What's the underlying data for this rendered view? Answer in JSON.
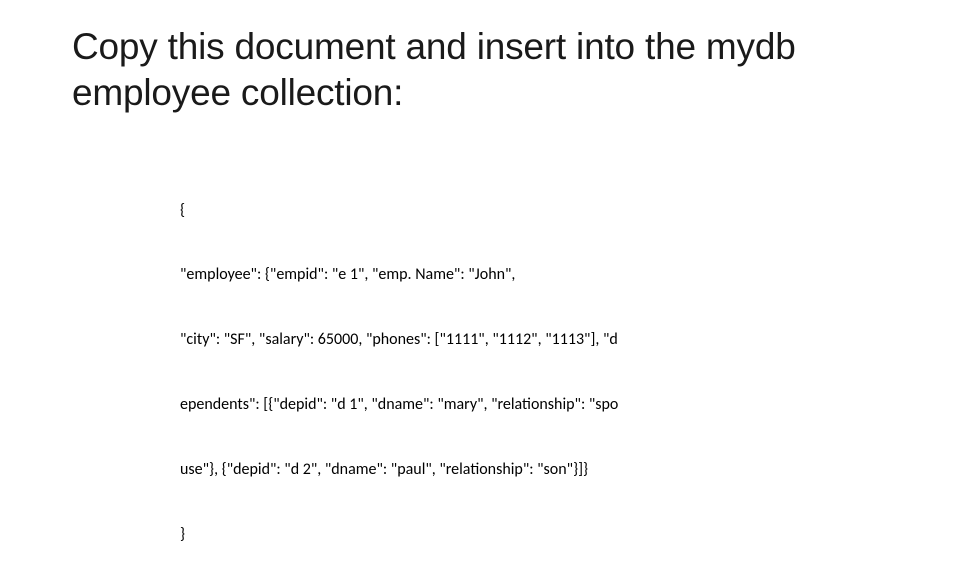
{
  "title": "Copy this document and insert into the mydb employee collection:",
  "code": {
    "line1": "{",
    "line2": "\"employee\": {\"empid\": \"e 1\", \"emp. Name\": \"John\",",
    "line3": "\"city\": \"SF\", \"salary\": 65000, \"phones\": [\"1111\", \"1112\", \"1113\"], \"d",
    "line4": "ependents\": [{\"depid\": \"d 1\", \"dname\": \"mary\", \"relationship\": \"spo",
    "line5": "use\"}, {\"depid\": \"d 2\", \"dname\": \"paul\", \"relationship\": \"son\"}]}",
    "line6": "}"
  }
}
